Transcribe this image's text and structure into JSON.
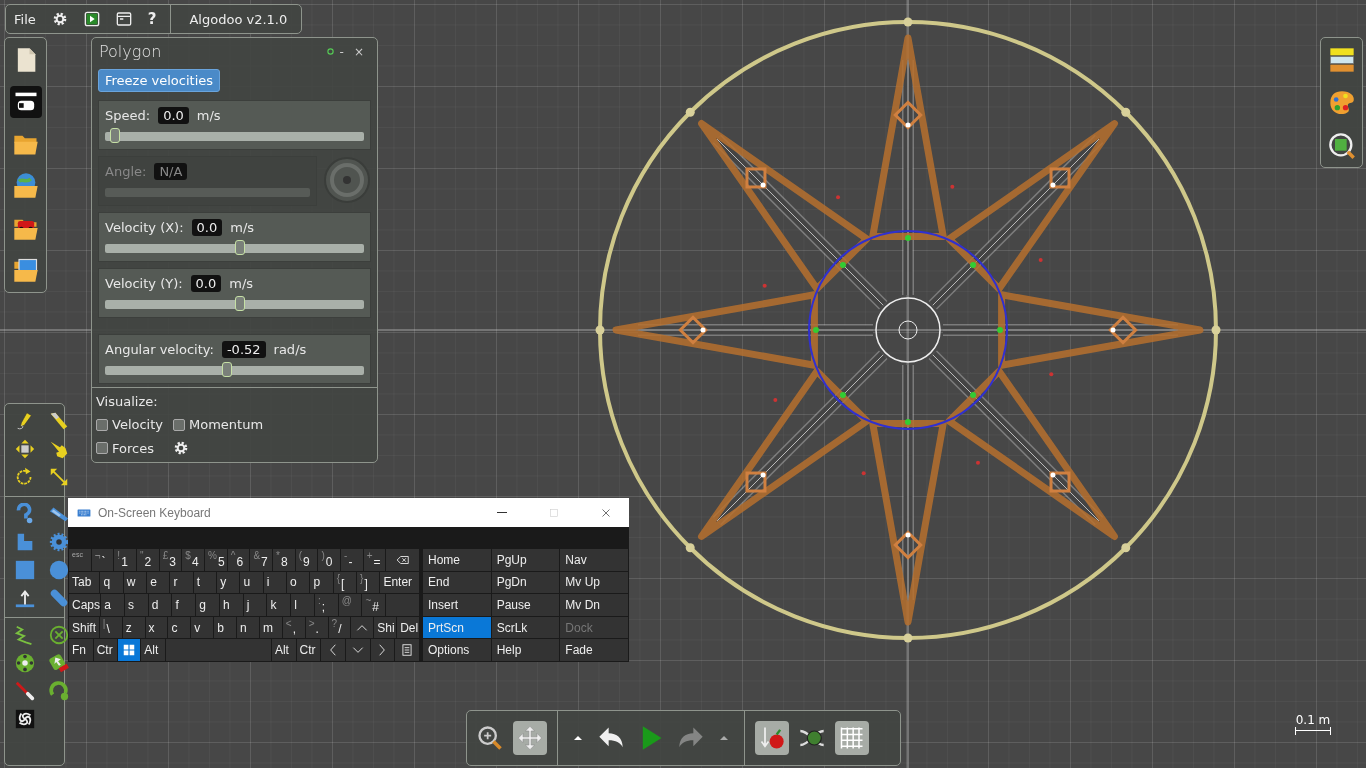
{
  "menu_bar": {
    "file": "File",
    "help": "?",
    "version": "Algodoo v2.1.0"
  },
  "file_bar": {
    "buttons": [
      {
        "kind": "new",
        "on": false
      },
      {
        "kind": "panels",
        "on": true
      },
      {
        "kind": "open",
        "on": false
      },
      {
        "kind": "browse",
        "on": false
      },
      {
        "kind": "scenes",
        "on": false
      },
      {
        "kind": "lessons",
        "on": false
      }
    ]
  },
  "polygon_panel": {
    "title": "Polygon",
    "minimize": "-",
    "close": "×",
    "freeze_button": "Freeze velocities",
    "fields": [
      {
        "kind": "slider",
        "label": "Speed:",
        "value": "0.0",
        "unit": "m/s",
        "level": 0,
        "disabled": false
      },
      {
        "kind": "dial",
        "label": "Angle:",
        "value": "N/A",
        "disabled": true
      },
      {
        "kind": "slider",
        "label": "Velocity (X):",
        "value": "0.0",
        "unit": "m/s",
        "level": 0.5,
        "disabled": false
      },
      {
        "kind": "slider",
        "label": "Velocity (Y):",
        "value": "0.0",
        "unit": "m/s",
        "level": 0.5,
        "disabled": false
      },
      {
        "kind": "slider",
        "label": "Angular velocity:",
        "value": "-0.52",
        "unit": "rad/s",
        "level": 0.45,
        "disabled": false
      }
    ],
    "visualize": {
      "label": "Visualize:",
      "options": [
        {
          "label": "Velocity",
          "checked": false
        },
        {
          "label": "Momentum",
          "checked": false
        },
        {
          "label": "Forces",
          "checked": false
        }
      ]
    }
  },
  "keyboard": {
    "title": "On-Screen Keyboard",
    "rows": [
      [
        {
          "kind": "small",
          "label": "esc",
          "on": false
        },
        {
          "kind": "key",
          "shift": "¬",
          "label": "`",
          "on": false
        },
        {
          "kind": "key",
          "shift": "!",
          "label": "1",
          "on": false
        },
        {
          "kind": "key",
          "shift": "\"",
          "label": "2",
          "on": false
        },
        {
          "kind": "key",
          "shift": "£",
          "label": "3",
          "on": false
        },
        {
          "kind": "key",
          "shift": "$",
          "label": "4",
          "on": false
        },
        {
          "kind": "key",
          "shift": "%",
          "label": "5",
          "on": false
        },
        {
          "kind": "key",
          "shift": "^",
          "label": "6",
          "on": false
        },
        {
          "kind": "key",
          "shift": "&",
          "label": "7",
          "on": false
        },
        {
          "kind": "key",
          "shift": "*",
          "label": "8",
          "on": false
        },
        {
          "kind": "key",
          "shift": "(",
          "label": "9",
          "on": false
        },
        {
          "kind": "key",
          "shift": ")",
          "label": "0",
          "on": false
        },
        {
          "kind": "key",
          "shift": "-",
          "label": "-",
          "on": false
        },
        {
          "kind": "key",
          "shift": "+",
          "label": "=",
          "on": false
        },
        {
          "kind": "backspace",
          "on": false
        }
      ],
      [
        {
          "kind": "wide",
          "label": "Tab",
          "on": false
        },
        {
          "kind": "key",
          "label": "q",
          "on": false
        },
        {
          "kind": "key",
          "label": "w",
          "on": false
        },
        {
          "kind": "key",
          "label": "e",
          "on": false
        },
        {
          "kind": "key",
          "label": "r",
          "on": false
        },
        {
          "kind": "key",
          "label": "t",
          "on": false
        },
        {
          "kind": "key",
          "label": "y",
          "on": false
        },
        {
          "kind": "key",
          "label": "u",
          "on": false
        },
        {
          "kind": "key",
          "label": "i",
          "on": false
        },
        {
          "kind": "key",
          "label": "o",
          "on": false
        },
        {
          "kind": "key",
          "label": "p",
          "on": false
        },
        {
          "kind": "key",
          "shift": "{",
          "label": "[",
          "on": false
        },
        {
          "kind": "key",
          "shift": "}",
          "label": "]",
          "on": false
        },
        {
          "kind": "enter",
          "label": "Enter",
          "on": false
        }
      ],
      [
        {
          "kind": "wide",
          "label": "Caps",
          "on": false
        },
        {
          "kind": "key",
          "label": "a",
          "on": false
        },
        {
          "kind": "key",
          "label": "s",
          "on": false
        },
        {
          "kind": "key",
          "label": "d",
          "on": false
        },
        {
          "kind": "key",
          "label": "f",
          "on": false
        },
        {
          "kind": "key",
          "label": "g",
          "on": false
        },
        {
          "kind": "key",
          "label": "h",
          "on": false
        },
        {
          "kind": "key",
          "label": "j",
          "on": false
        },
        {
          "kind": "key",
          "label": "k",
          "on": false
        },
        {
          "kind": "key",
          "label": "l",
          "on": false
        },
        {
          "kind": "key",
          "shift": ":",
          "label": ";",
          "on": false
        },
        {
          "kind": "key",
          "shift": "@",
          "on": false
        },
        {
          "kind": "key",
          "shift": "~",
          "label": "#",
          "on": false
        },
        {
          "kind": "gap",
          "on": false
        }
      ],
      [
        {
          "kind": "wide",
          "label": "Shift",
          "on": false
        },
        {
          "kind": "key",
          "shift": "|",
          "label": "\\",
          "on": false
        },
        {
          "kind": "key",
          "label": "z",
          "on": false
        },
        {
          "kind": "key",
          "label": "x",
          "on": false
        },
        {
          "kind": "key",
          "label": "c",
          "on": false
        },
        {
          "kind": "key",
          "label": "v",
          "on": false
        },
        {
          "kind": "key",
          "label": "b",
          "on": false
        },
        {
          "kind": "key",
          "label": "n",
          "on": false
        },
        {
          "kind": "key",
          "label": "m",
          "on": false
        },
        {
          "kind": "key",
          "shift": "<",
          "label": ",",
          "on": false
        },
        {
          "kind": "key",
          "shift": ">",
          "label": ".",
          "on": false
        },
        {
          "kind": "key",
          "shift": "?",
          "label": "/",
          "on": false
        },
        {
          "kind": "up",
          "on": false
        },
        {
          "kind": "key",
          "label": "Shi",
          "on": false
        },
        {
          "kind": "key",
          "label": "Del",
          "on": false
        }
      ],
      [
        {
          "kind": "key",
          "label": "Fn",
          "on": false
        },
        {
          "kind": "key",
          "label": "Ctr",
          "on": false
        },
        {
          "kind": "windows",
          "on": true
        },
        {
          "kind": "key",
          "label": "Alt",
          "on": false
        },
        {
          "kind": "space",
          "on": false
        },
        {
          "kind": "key",
          "label": "Alt",
          "on": false
        },
        {
          "kind": "key",
          "label": "Ctr",
          "on": false
        },
        {
          "kind": "left",
          "on": false
        },
        {
          "kind": "down",
          "on": false
        },
        {
          "kind": "right",
          "on": false
        },
        {
          "kind": "menu",
          "on": false
        }
      ]
    ],
    "nav_keys": [
      {
        "label": "Home",
        "on": false,
        "disabled": false
      },
      {
        "label": "PgUp",
        "on": false,
        "disabled": false
      },
      {
        "label": "Nav",
        "on": false,
        "disabled": false
      },
      {
        "label": "End",
        "on": false,
        "disabled": false
      },
      {
        "label": "PgDn",
        "on": false,
        "disabled": false
      },
      {
        "label": "Mv Up",
        "on": false,
        "disabled": false
      },
      {
        "label": "Insert",
        "on": false,
        "disabled": false
      },
      {
        "label": "Pause",
        "on": false,
        "disabled": false
      },
      {
        "label": "Mv Dn",
        "on": false,
        "disabled": false
      },
      {
        "label": "PrtScn",
        "on": true,
        "disabled": false
      },
      {
        "label": "ScrLk",
        "on": false,
        "disabled": false
      },
      {
        "label": "Dock",
        "on": false,
        "disabled": true
      },
      {
        "label": "Options",
        "on": false,
        "disabled": false
      },
      {
        "label": "Help",
        "on": false,
        "disabled": false
      },
      {
        "label": "Fade",
        "on": false,
        "disabled": false
      }
    ]
  },
  "bottom_toolbar": {
    "buttons": [
      {
        "kind": "zoom",
        "on": false,
        "disabled": false
      },
      {
        "kind": "pan",
        "on": true,
        "disabled": false
      },
      {
        "kind": "caret",
        "on": false,
        "disabled": false
      },
      {
        "kind": "undo",
        "on": false,
        "disabled": false
      },
      {
        "kind": "play",
        "on": false,
        "disabled": false
      },
      {
        "kind": "redo",
        "on": false,
        "disabled": true
      },
      {
        "kind": "caret",
        "on": false,
        "disabled": true
      },
      {
        "kind": "gravity",
        "on": true,
        "disabled": false
      },
      {
        "kind": "sync",
        "on": false,
        "disabled": false
      },
      {
        "kind": "grid",
        "on": true,
        "disabled": false
      }
    ]
  },
  "scale_bar": {
    "label": "0.1 m"
  }
}
